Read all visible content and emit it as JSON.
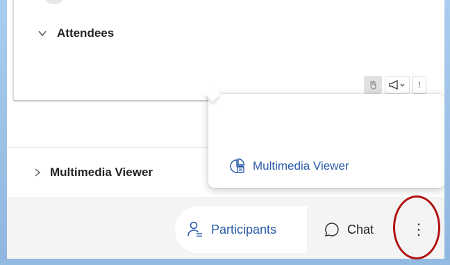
{
  "attendees_section": {
    "label": "Attendees"
  },
  "multimedia_section": {
    "label": "Multimedia Viewer"
  },
  "popup_menu": {
    "items": [
      {
        "label": "Multimedia Viewer",
        "icon": "multimedia-viewer-icon"
      }
    ]
  },
  "bottom_bar": {
    "participants_label": "Participants",
    "chat_label": "Chat",
    "more_symbol": "⋮"
  },
  "toolbar": {
    "extra_label": "!"
  },
  "colors": {
    "accent": "#2a5aa8",
    "highlight": "#b01212",
    "frame": "#9ec3e6"
  }
}
